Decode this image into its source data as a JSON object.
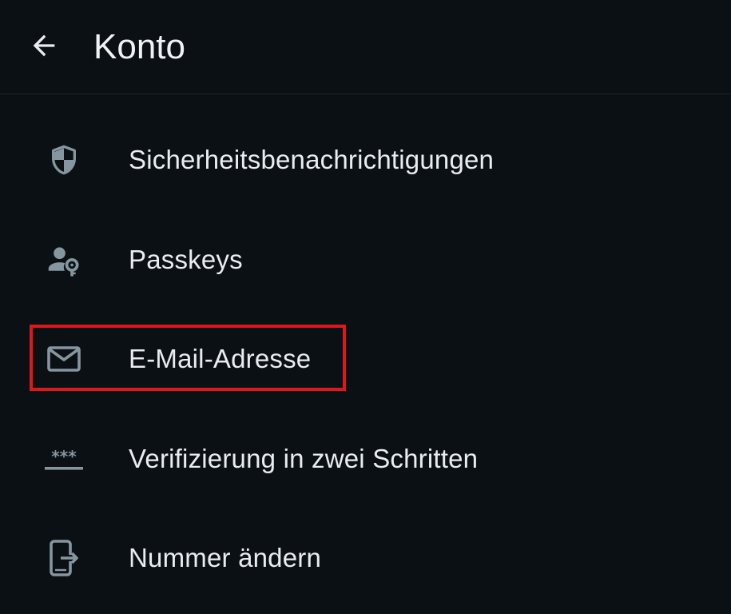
{
  "header": {
    "title": "Konto",
    "back_icon": "arrow-back-icon"
  },
  "menu": {
    "items": [
      {
        "label": "Sicherheitsbenachrichtigungen",
        "icon": "shield-icon"
      },
      {
        "label": "Passkeys",
        "icon": "person-key-icon"
      },
      {
        "label": "E-Mail-Adresse",
        "icon": "mail-icon"
      },
      {
        "label": "Verifizierung in zwei Schritten",
        "icon": "asterisk-password-icon"
      },
      {
        "label": "Nummer ändern",
        "icon": "phone-change-icon"
      }
    ]
  },
  "colors": {
    "background": "#0b1014",
    "text": "#e9edef",
    "icon": "#8696a0",
    "highlight": "#e0161b"
  }
}
